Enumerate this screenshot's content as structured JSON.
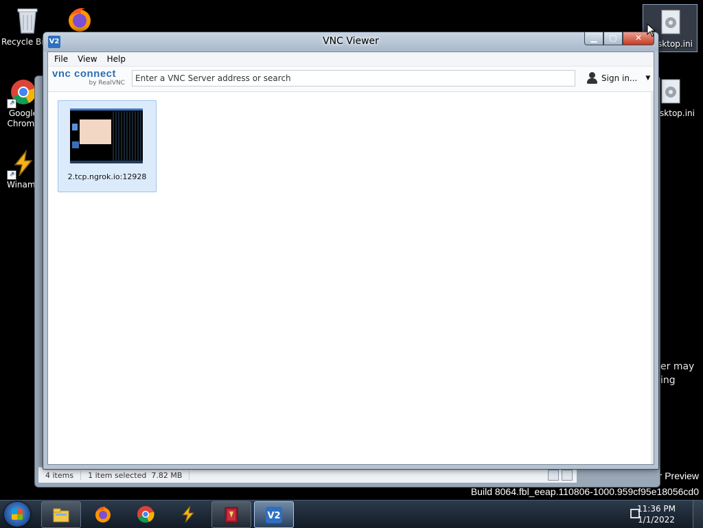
{
  "desktop": {
    "icons": [
      {
        "name": "recycle-bin-icon",
        "label": "Recycle Bin"
      },
      {
        "name": "firefox-icon",
        "label": ""
      },
      {
        "name": "chrome-icon",
        "label": "Google Chrome"
      },
      {
        "name": "winamp-icon",
        "label": "Winamp"
      }
    ],
    "right_icons": [
      {
        "label": "desktop.ini"
      },
      {
        "label": "desktop.ini"
      }
    ],
    "watermark": {
      "line1": "Windows Developer Preview",
      "line2": "Build 8064.fbl_eeap.110806-1000.959cf95e18056cd0"
    },
    "fragments": [
      "er may",
      "ing"
    ]
  },
  "background_window": {
    "status": {
      "items_count": "4 items",
      "selected": "1 item selected  7.82 MB"
    }
  },
  "vnc_window": {
    "title": "VNC Viewer",
    "app_icon_text": "V2",
    "menu": [
      "File",
      "View",
      "Help"
    ],
    "logo": {
      "brand": "vnc connect",
      "byline": "by RealVNC"
    },
    "search": {
      "placeholder": "Enter a VNC Server address or search",
      "value": ""
    },
    "signin_label": "Sign in...",
    "connections": [
      {
        "label": "2.tcp.ngrok.io:12928",
        "selected": true
      }
    ]
  },
  "taskbar": {
    "apps": [
      {
        "name": "explorer",
        "icon": "folder-icon",
        "active": false
      },
      {
        "name": "firefox",
        "icon": "firefox-icon",
        "active": false
      },
      {
        "name": "chrome",
        "icon": "chrome-icon",
        "active": false
      },
      {
        "name": "winamp",
        "icon": "winamp-icon",
        "active": false
      },
      {
        "name": "winrar",
        "icon": "winrar-icon",
        "active": false
      },
      {
        "name": "vnc-viewer",
        "icon": "vnc-viewer-icon",
        "active": true
      }
    ],
    "clock": {
      "time": "11:36 PM",
      "date": "1/1/2022"
    }
  },
  "colors": {
    "accent": "#2a6db5",
    "selection": "#dcebfb",
    "close": "#c73b22"
  }
}
